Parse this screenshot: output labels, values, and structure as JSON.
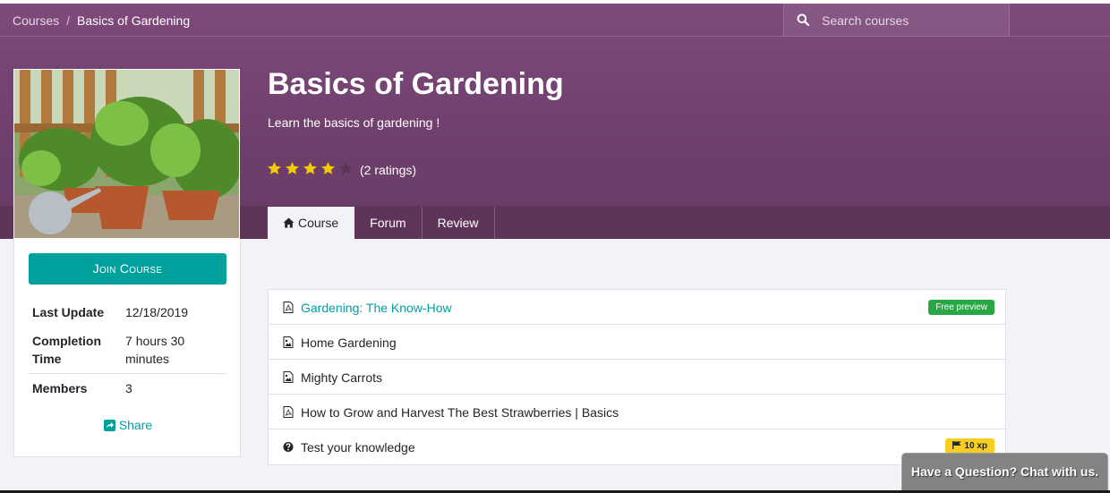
{
  "breadcrumb": {
    "root": "Courses",
    "separator": "/",
    "current": "Basics of Gardening"
  },
  "search": {
    "placeholder": "Search courses",
    "icon": "search-icon"
  },
  "course": {
    "title": "Basics of Gardening",
    "subtitle": "Learn the basics of gardening !",
    "rating_stars": 4,
    "rating_max": 5,
    "ratings_text": "(2 ratings)"
  },
  "tabs": [
    {
      "label": "Course",
      "icon": "home-icon",
      "active": true
    },
    {
      "label": "Forum",
      "active": false
    },
    {
      "label": "Review",
      "active": false
    }
  ],
  "sidebar": {
    "join_label": "Join Course",
    "info": [
      {
        "key": "Last Update",
        "value": "12/18/2019"
      },
      {
        "key": "Completion Time",
        "value": "7 hours 30 minutes"
      },
      {
        "key": "Members",
        "value": "3"
      }
    ],
    "share_label": "Share"
  },
  "contents": [
    {
      "label": "Gardening: The Know-How",
      "icon": "pdf-file-icon",
      "badge": "Free preview",
      "link": true
    },
    {
      "label": "Home Gardening",
      "icon": "image-file-icon"
    },
    {
      "label": "Mighty Carrots",
      "icon": "image-file-icon"
    },
    {
      "label": "How to Grow and Harvest The Best Strawberries | Basics",
      "icon": "pdf-file-icon"
    },
    {
      "label": "Test your knowledge",
      "icon": "question-circle-icon",
      "badge": "10 xp"
    }
  ],
  "chat": {
    "label": "Have a Question? Chat with us."
  },
  "colors": {
    "hero": "#7e4a7b",
    "accent": "#00a09d",
    "free_badge": "#28a745",
    "xp_badge": "#f7cd1f",
    "star": "#f3cc00"
  }
}
